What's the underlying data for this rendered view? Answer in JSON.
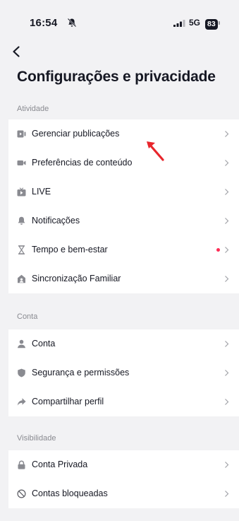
{
  "status": {
    "time": "16:54",
    "network": "5G",
    "battery": "83"
  },
  "title": "Configurações e privacidade",
  "sections": [
    {
      "label": "Atividade",
      "items": [
        {
          "label": "Gerenciar publicações",
          "icon": "posts-icon"
        },
        {
          "label": "Preferências de conteúdo",
          "icon": "video-icon"
        },
        {
          "label": "LIVE",
          "icon": "live-icon"
        },
        {
          "label": "Notificações",
          "icon": "bell-icon"
        },
        {
          "label": "Tempo e bem-estar",
          "icon": "hourglass-icon",
          "has_badge": true
        },
        {
          "label": "Sincronização Familiar",
          "icon": "family-icon"
        }
      ]
    },
    {
      "label": "Conta",
      "items": [
        {
          "label": "Conta",
          "icon": "person-icon"
        },
        {
          "label": "Segurança e permissões",
          "icon": "shield-icon"
        },
        {
          "label": "Compartilhar perfil",
          "icon": "share-icon"
        }
      ]
    },
    {
      "label": "Visibilidade",
      "items": [
        {
          "label": "Conta Privada",
          "icon": "lock-icon"
        },
        {
          "label": "Contas bloqueadas",
          "icon": "block-icon"
        }
      ]
    }
  ],
  "colors": {
    "badge": "#fe2c55",
    "annotation_arrow": "#e8262c",
    "background": "#f2f2f4"
  }
}
